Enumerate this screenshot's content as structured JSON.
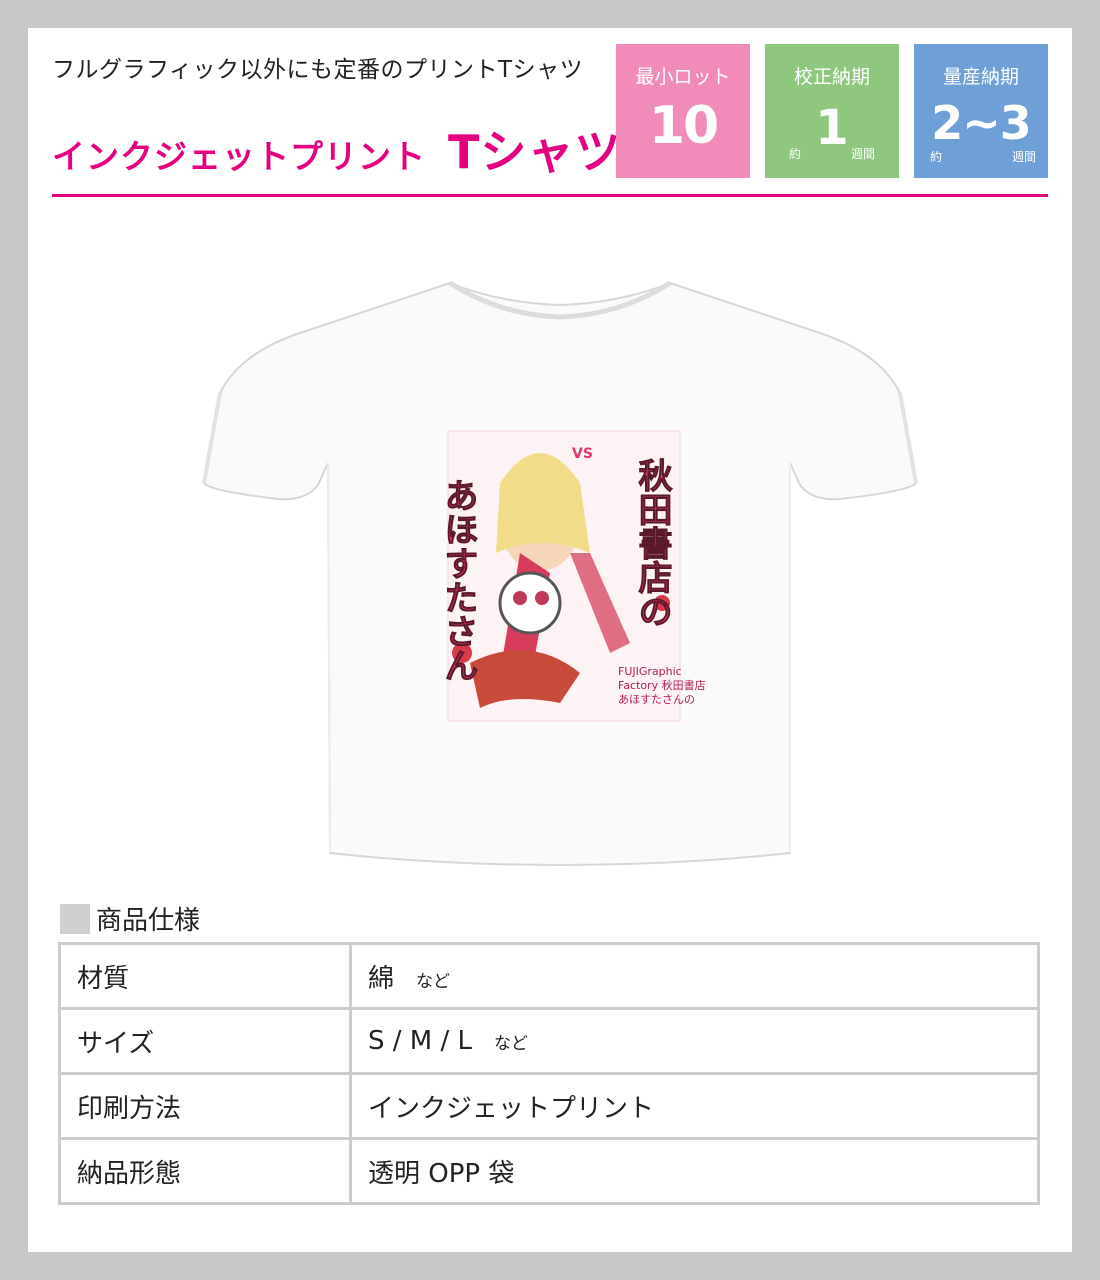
{
  "header": {
    "subtitle": "フルグラフィック以外にも定番のプリントTシャツ",
    "title_part1": "インクジェットプリント",
    "title_part2": "Tシャツ",
    "accent_color": "#e4007f"
  },
  "badges": [
    {
      "label": "最小ロット",
      "value": "10",
      "prefix": "",
      "suffix": "",
      "color": "#f18bb9"
    },
    {
      "label": "校正納期",
      "value": "1",
      "prefix": "約",
      "suffix": "週間",
      "color": "#8fc77e"
    },
    {
      "label": "量産納期",
      "value": "2~3",
      "prefix": "約",
      "suffix": "週間",
      "color": "#6e9fd6"
    }
  ],
  "product_image": {
    "icon": "tshirt-icon",
    "print_text_left": "あほすたさん",
    "print_text_right": "秋田書店の",
    "print_logo_lines": [
      "FUJIGraphic",
      "Factory 秋田書店",
      "あほすたさんの"
    ],
    "print_small": "VS"
  },
  "spec": {
    "heading": "商品仕様",
    "rows": [
      {
        "key": "材質",
        "value": "綿",
        "note": "など"
      },
      {
        "key": "サイズ",
        "value": "S / M / L",
        "note": "など"
      },
      {
        "key": "印刷方法",
        "value": "インクジェットプリント",
        "note": ""
      },
      {
        "key": "納品形態",
        "value": "透明 OPP 袋",
        "note": ""
      }
    ]
  }
}
